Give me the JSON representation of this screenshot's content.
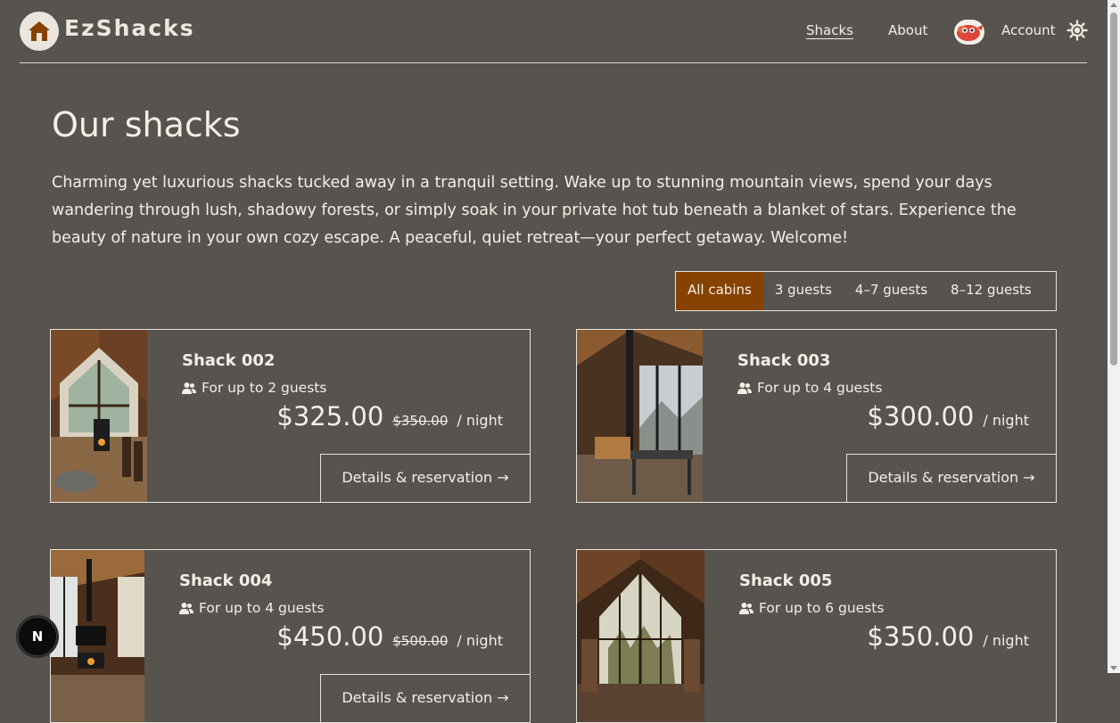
{
  "brand": {
    "name": "EzShacks",
    "logo_icon": "house-icon"
  },
  "nav": {
    "shacks": "Shacks",
    "about": "About",
    "account": "Account",
    "theme_icon": "sun-icon"
  },
  "page": {
    "title": "Our shacks",
    "intro": "Charming yet luxurious shacks tucked away in a tranquil setting. Wake up to stunning mountain views, spend your days wandering through lush, shadowy forests, or simply soak in your private hot tub beneath a blanket of stars. Experience the beauty of nature in your own cozy escape. A peaceful, quiet retreat—your perfect getaway. Welcome!"
  },
  "filters": {
    "all": "All cabins",
    "small": "3 guests",
    "medium": "4–7 guests",
    "large": "8–12 guests",
    "active": "All cabins"
  },
  "cards": [
    {
      "name": "Shack 002",
      "guests": "For up to 2 guests",
      "price": "$325.00",
      "old_price": "$350.00",
      "per_night": "/ night",
      "cta": "Details & reservation →"
    },
    {
      "name": "Shack 003",
      "guests": "For up to 4 guests",
      "price": "$300.00",
      "old_price": "",
      "per_night": "/ night",
      "cta": "Details & reservation →"
    },
    {
      "name": "Shack 004",
      "guests": "For up to 4 guests",
      "price": "$450.00",
      "old_price": "$500.00",
      "per_night": "/ night",
      "cta": "Details & reservation →"
    },
    {
      "name": "Shack 005",
      "guests": "For up to 6 guests",
      "price": "$350.00",
      "old_price": "",
      "per_night": "/ night",
      "cta": "Details & reservation →"
    }
  ],
  "dev_badge": {
    "label": "N"
  },
  "colors": {
    "background": "#57534e",
    "accent": "#864201",
    "text": "#f2efe9",
    "border": "#e8e4dc"
  }
}
